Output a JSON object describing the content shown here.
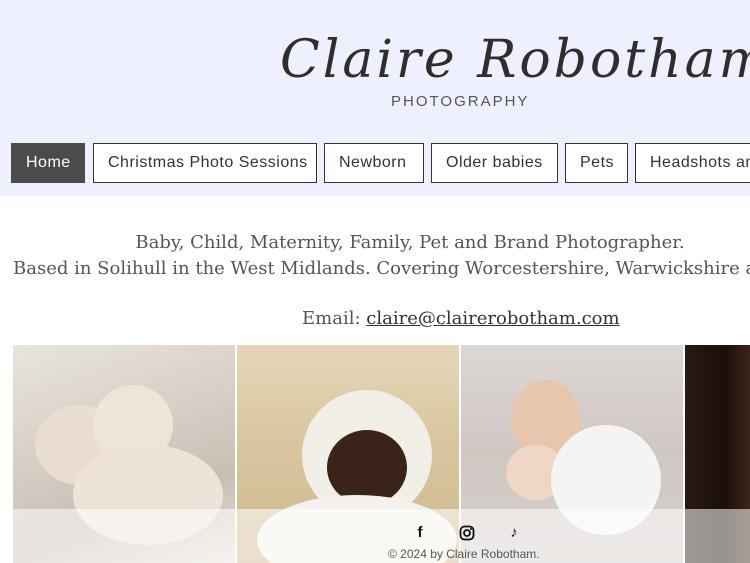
{
  "header": {
    "logo_name": "Claire Robotham",
    "logo_subtitle": "PHOTOGRAPHY"
  },
  "nav": {
    "items": [
      {
        "label": "Home",
        "active": true
      },
      {
        "label": "Christmas Photo Sessions",
        "active": false
      },
      {
        "label": "Newborn",
        "active": false
      },
      {
        "label": "Older babies",
        "active": false
      },
      {
        "label": "Pets",
        "active": false
      },
      {
        "label": "Headshots and",
        "active": false
      }
    ]
  },
  "intro": {
    "line1": "Baby, Child, Maternity, Family, Pet and Brand Photographer.",
    "line2": "Based in Solihull in the West Midlands. Covering Worcestershire, Warwickshire and",
    "email_label": "Email:",
    "email": "claire@clairerobotham.com"
  },
  "gallery": {
    "photos": [
      "newborn-twins-photo",
      "newborn-bonnet-photo",
      "sibling-hug-photo",
      "portrait-photo"
    ]
  },
  "footer": {
    "social_icons": [
      "facebook-icon",
      "instagram-icon",
      "tiktok-icon"
    ],
    "copyright": "© 2024 by Claire Robotham."
  },
  "colors": {
    "header_bg": "#eef0fd",
    "nav_active_bg": "#4b4b4b",
    "text": "#555555"
  }
}
